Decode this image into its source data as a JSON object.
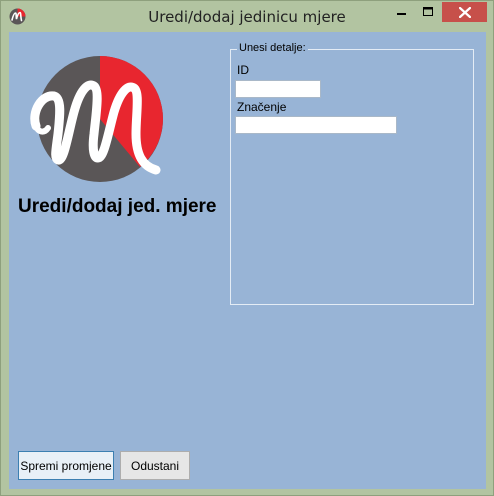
{
  "window": {
    "title": "Uredi/dodaj jedinicu mjere"
  },
  "heading": "Uredi/dodaj jed. mjere",
  "details_group": {
    "legend": "Unesi detalje:",
    "id_label": "ID",
    "id_value": "",
    "meaning_label": "Značenje",
    "meaning_value": ""
  },
  "buttons": {
    "save": "Spremi promjene",
    "cancel": "Odustani"
  },
  "icons": {
    "app": "app-logo-icon",
    "minimize": "minimize-icon",
    "maximize": "maximize-icon",
    "close": "close-icon"
  },
  "colors": {
    "client_bg": "#98b4d6",
    "frame": "#b2c4a1",
    "close_button": "#c7504a",
    "logo_red": "#e8262f",
    "logo_dark": "#5a5657"
  }
}
